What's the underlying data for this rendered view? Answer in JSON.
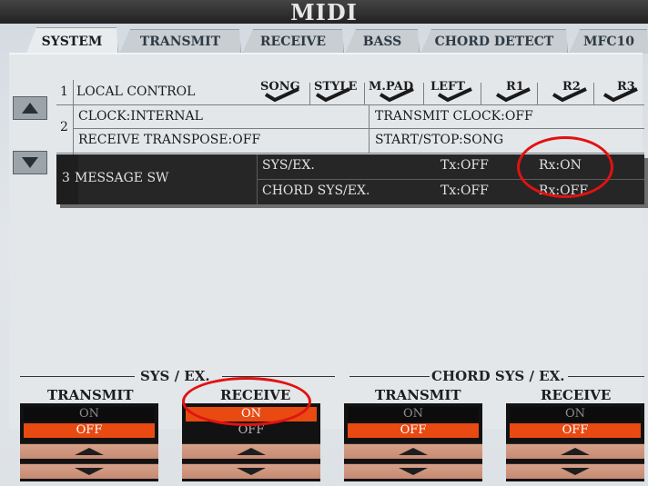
{
  "window": {
    "title": "MIDI"
  },
  "tabs": [
    {
      "label": "SYSTEM",
      "active": true
    },
    {
      "label": "TRANSMIT",
      "active": false
    },
    {
      "label": "RECEIVE",
      "active": false
    },
    {
      "label": "BASS",
      "active": false
    },
    {
      "label": "CHORD DETECT",
      "active": false
    },
    {
      "label": "MFC10",
      "active": false
    }
  ],
  "table": {
    "columns": [
      "SONG",
      "STYLE",
      "M.PAD",
      "LEFT",
      "R1",
      "R2",
      "R3"
    ],
    "row1": {
      "num": "1",
      "label": "LOCAL CONTROL",
      "checks": [
        true,
        true,
        true,
        true,
        true,
        true,
        true
      ]
    },
    "row2": {
      "num": "2",
      "clock": "CLOCK:INTERNAL",
      "transmit_clock": "TRANSMIT CLOCK:OFF",
      "receive_transpose": "RECEIVE TRANSPOSE:OFF",
      "start_stop": "START/STOP:SONG"
    },
    "row3": {
      "num": "3",
      "label": "MESSAGE SW",
      "sysex": {
        "name": "SYS/EX.",
        "tx": "Tx:OFF",
        "rx": "Rx:ON"
      },
      "chord_sysex": {
        "name": "CHORD SYS/EX.",
        "tx": "Tx:OFF",
        "rx": "Rx:OFF"
      }
    }
  },
  "bottom": {
    "sysex_title": "SYS / EX.",
    "chord_title": "CHORD SYS / EX.",
    "controls": [
      {
        "header": "TRANSMIT",
        "on": "ON",
        "off": "OFF",
        "selected": "OFF"
      },
      {
        "header": "RECEIVE",
        "on": "ON",
        "off": "OFF",
        "selected": "ON"
      },
      {
        "header": "TRANSMIT",
        "on": "ON",
        "off": "OFF",
        "selected": "OFF"
      },
      {
        "header": "RECEIVE",
        "on": "ON",
        "off": "OFF",
        "selected": "OFF"
      }
    ]
  },
  "colors": {
    "selected_option": "#e84a12",
    "annotation_circle": "#e11212"
  },
  "icons": {
    "scroll_up": "triangle-up-icon",
    "scroll_down": "triangle-down-icon",
    "check": "check-icon"
  }
}
